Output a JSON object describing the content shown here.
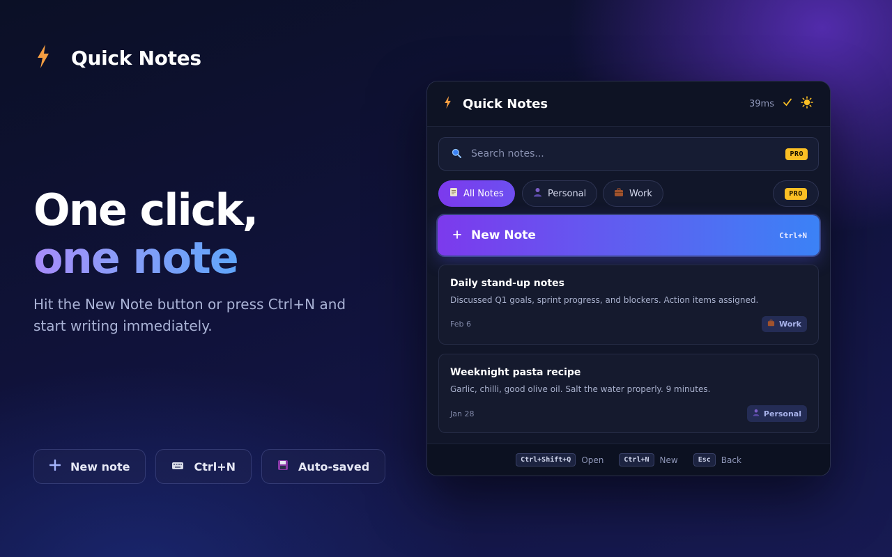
{
  "app": {
    "name": "Quick Notes"
  },
  "hero": {
    "headline_line1": "One click,",
    "headline_line2": "one note",
    "subtitle": "Hit the New Note button or press Ctrl+N and start writing immediately."
  },
  "feature_chips": [
    {
      "label": "New note",
      "icon": "plus-icon"
    },
    {
      "label": "Ctrl+N",
      "icon": "keyboard-icon"
    },
    {
      "label": "Auto-saved",
      "icon": "floppy-disk-icon"
    }
  ],
  "panel": {
    "title": "Quick Notes",
    "latency": "39ms",
    "status_icon": "checkmark-icon",
    "theme_icon": "sun-icon",
    "search": {
      "placeholder": "Search notes...",
      "badge": "PRO"
    },
    "tabs": [
      {
        "label": "All Notes",
        "icon": "notepad-icon",
        "active": true
      },
      {
        "label": "Personal",
        "icon": "person-icon",
        "active": false
      },
      {
        "label": "Work",
        "icon": "briefcase-icon",
        "active": false
      }
    ],
    "tabs_badge": "PRO",
    "new_note": {
      "label": "New Note",
      "shortcut": "Ctrl+N"
    },
    "notes": [
      {
        "title": "Daily stand-up notes",
        "body": "Discussed Q1 goals, sprint progress, and blockers. Action items assigned.",
        "date": "Feb 6",
        "tag": "Work",
        "tag_icon": "briefcase-icon"
      },
      {
        "title": "Weeknight pasta recipe",
        "body": "Garlic, chilli, good olive oil. Salt the water properly. 9 minutes.",
        "date": "Jan 28",
        "tag": "Personal",
        "tag_icon": "person-icon"
      }
    ],
    "footer": [
      {
        "key": "Ctrl+Shift+Q",
        "label": "Open"
      },
      {
        "key": "Ctrl+N",
        "label": "New"
      },
      {
        "key": "Esc",
        "label": "Back"
      }
    ]
  },
  "colors": {
    "accent_purple": "#7c3aed",
    "accent_blue": "#3b82f6",
    "bolt_orange": "#f59e42",
    "pro_yellow": "#fbbf24"
  }
}
